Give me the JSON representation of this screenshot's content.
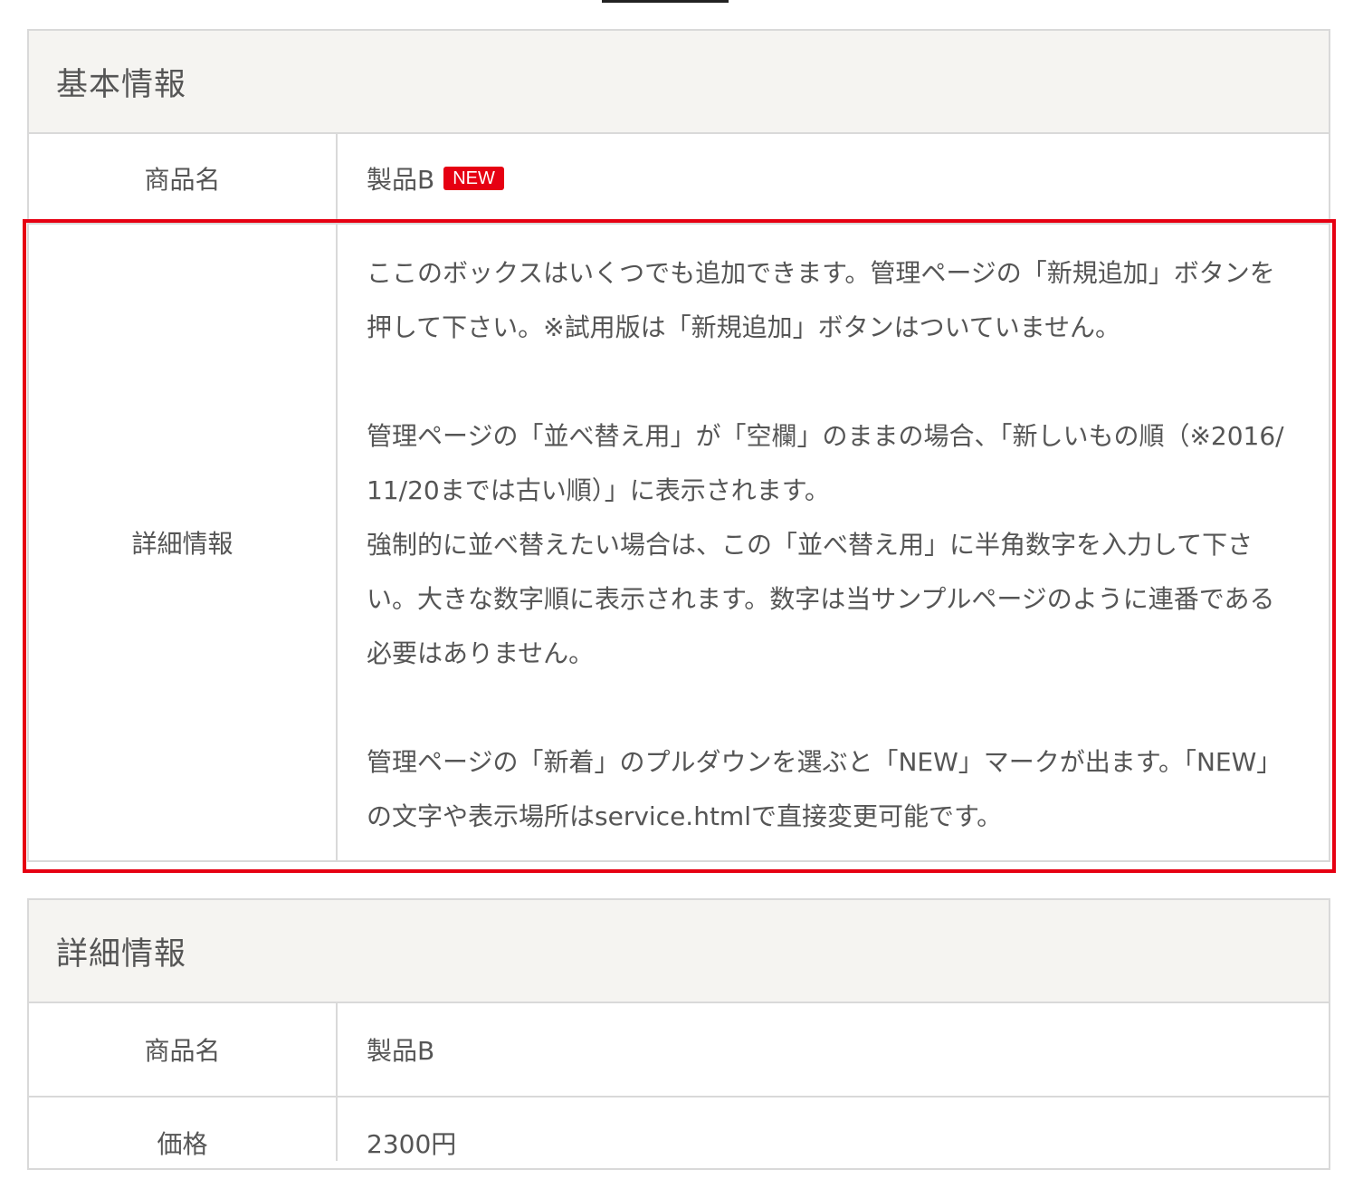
{
  "basic_section": {
    "title": "基本情報",
    "product_label": "商品名",
    "product_value": "製品B",
    "new_badge": "NEW",
    "detail_label": "詳細情報",
    "detail_paragraphs": [
      "ここのボックスはいくつでも追加できます。管理ページの「新規追加」ボタンを押して下さい。※試用版は「新規追加」ボタンはついていません。",
      "",
      "管理ページの「並べ替え用」が「空欄」のままの場合、「新しいもの順（※2016/11/20までは古い順）」に表示されます。",
      "強制的に並べ替えたい場合は、この「並べ替え用」に半角数字を入力して下さい。大きな数字順に表示されます。数字は当サンプルページのように連番である必要はありません。",
      "",
      "管理ページの「新着」のプルダウンを選ぶと「NEW」マークが出ます。「NEW」の文字や表示場所はservice.htmlで直接変更可能です。"
    ]
  },
  "detail_section": {
    "title": "詳細情報",
    "product_label": "商品名",
    "product_value": "製品B",
    "price_label": "価格",
    "price_value": "2300円"
  },
  "colors": {
    "highlight": "#e60012",
    "badge_bg": "#e60012",
    "header_bg": "#f5f4f1",
    "border": "#d9d9d9",
    "text": "#555555"
  }
}
